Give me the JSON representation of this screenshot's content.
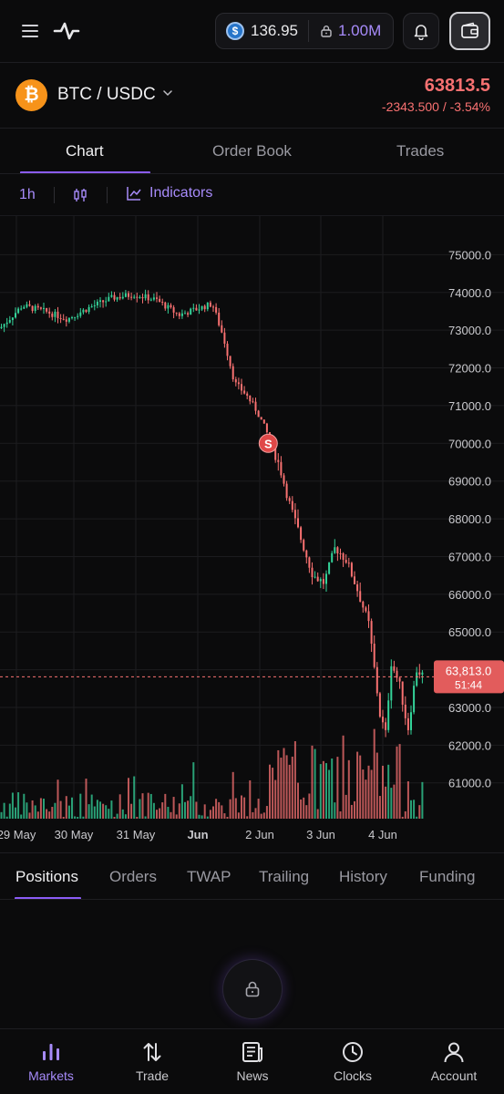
{
  "header": {
    "balance": "136.95",
    "leverage": "1.00M"
  },
  "market": {
    "pair": "BTC / USDC",
    "last_price": "63813.5",
    "change": "-2343.500 / -3.54%",
    "coin_glyph": "₿"
  },
  "chart_tabs": [
    {
      "label": "Chart",
      "active": true
    },
    {
      "label": "Order Book",
      "active": false
    },
    {
      "label": "Trades",
      "active": false
    }
  ],
  "toolbar": {
    "timeframe": "1h",
    "indicators_label": "Indicators"
  },
  "chart_data": {
    "type": "candlestick",
    "colors": {
      "up": "#34d399",
      "down": "#f87171",
      "grid": "#1c1c1f",
      "axis_text": "#c9c9cd"
    },
    "y_ticks": [
      "75000.0",
      "74000.0",
      "73000.0",
      "72000.0",
      "71000.0",
      "70000.0",
      "69000.0",
      "68000.0",
      "67000.0",
      "66000.0",
      "65000.0",
      "64000.0",
      "63000.0",
      "62000.0",
      "61000.0"
    ],
    "ylim": [
      60800,
      75300
    ],
    "x_ticks": [
      "29 May",
      "30 May",
      "31 May",
      "Jun",
      "2 Jun",
      "3 Jun",
      "4 Jun"
    ],
    "x_range": [
      "2024-05-29T12:00",
      "2024-06-04T20:00"
    ],
    "bold_tick": "Jun",
    "price_label": "63,813.0",
    "countdown_label": "51:44",
    "current_price": 63813.0,
    "trade_marker": {
      "label": "S",
      "time": "2024-06-02T12:00",
      "price": 70000
    },
    "close_path": [
      [
        "2024-05-29T12:00",
        73050
      ],
      [
        "2024-05-29T20:00",
        73650
      ],
      [
        "2024-05-30T04:00",
        73500
      ],
      [
        "2024-05-30T12:00",
        73300
      ],
      [
        "2024-05-30T20:00",
        73600
      ],
      [
        "2024-05-31T04:00",
        73850
      ],
      [
        "2024-05-31T12:00",
        73950
      ],
      [
        "2024-05-31T20:00",
        73800
      ],
      [
        "2024-06-01T04:00",
        73400
      ],
      [
        "2024-06-01T12:00",
        73600
      ],
      [
        "2024-06-01T16:00",
        73700
      ],
      [
        "2024-06-01T20:00",
        72800
      ],
      [
        "2024-06-02T00:00",
        71600
      ],
      [
        "2024-06-02T04:00",
        71300
      ],
      [
        "2024-06-02T08:00",
        70850
      ],
      [
        "2024-06-02T12:00",
        70200
      ],
      [
        "2024-06-02T16:00",
        69400
      ],
      [
        "2024-06-02T20:00",
        68300
      ],
      [
        "2024-06-03T00:00",
        67400
      ],
      [
        "2024-06-03T04:00",
        66500
      ],
      [
        "2024-06-03T08:00",
        66300
      ],
      [
        "2024-06-03T12:00",
        67250
      ],
      [
        "2024-06-03T16:00",
        66900
      ],
      [
        "2024-06-03T20:00",
        66100
      ],
      [
        "2024-06-04T00:00",
        65200
      ],
      [
        "2024-06-04T04:00",
        62800
      ],
      [
        "2024-06-04T06:00",
        62300
      ],
      [
        "2024-06-04T08:00",
        64200
      ],
      [
        "2024-06-04T11:00",
        63600
      ],
      [
        "2024-06-04T14:00",
        62400
      ],
      [
        "2024-06-04T17:00",
        64000
      ],
      [
        "2024-06-04T20:00",
        63813
      ]
    ]
  },
  "panel_tabs": [
    {
      "label": "Positions",
      "active": true
    },
    {
      "label": "Orders",
      "active": false
    },
    {
      "label": "TWAP",
      "active": false
    },
    {
      "label": "Trailing",
      "active": false
    },
    {
      "label": "History",
      "active": false
    },
    {
      "label": "Funding",
      "active": false
    }
  ],
  "nav": [
    {
      "label": "Markets",
      "icon": "bar-chart-icon",
      "active": true
    },
    {
      "label": "Trade",
      "icon": "swap-arrows-icon",
      "active": false
    },
    {
      "label": "News",
      "icon": "newspaper-icon",
      "active": false
    },
    {
      "label": "Clocks",
      "icon": "clock-icon",
      "active": false
    },
    {
      "label": "Account",
      "icon": "user-icon",
      "active": false
    }
  ]
}
